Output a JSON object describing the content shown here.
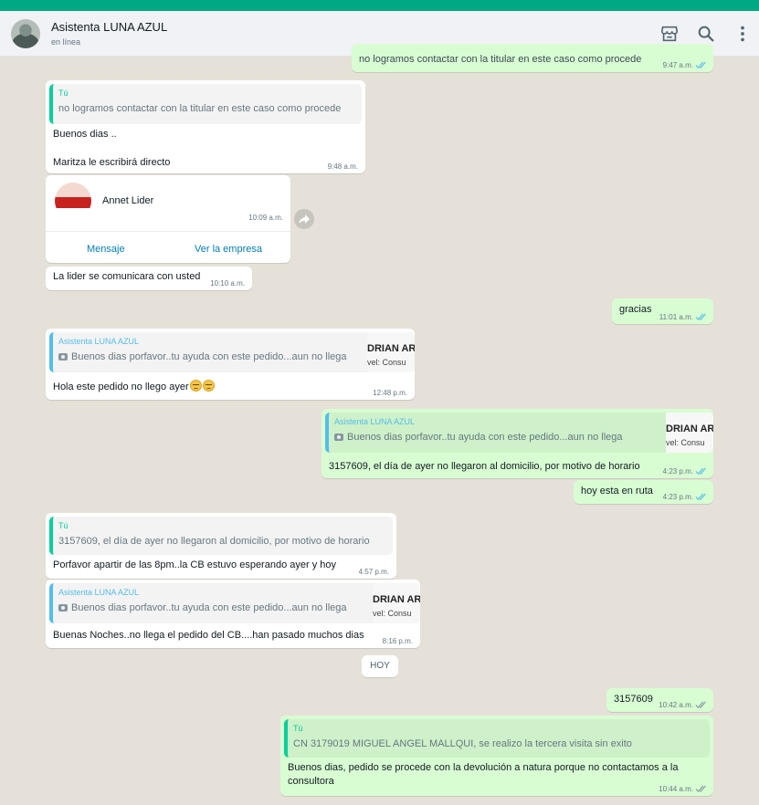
{
  "header": {
    "contact_name": "Asistenta LUNA AZUL",
    "status": "en línea",
    "icons": [
      "store-icon",
      "search-icon",
      "more-vert-icon"
    ]
  },
  "colors": {
    "accent": "#00a884",
    "outgoing": "#d9fdd3",
    "incoming": "#ffffff",
    "link": "#027eb5",
    "tick_read": "#53bdeb"
  },
  "messages": {
    "m0": {
      "text": "no logramos contactar con la titular en este caso como procede",
      "time": "9:47 a.m."
    },
    "m1": {
      "quote_author": "Tú",
      "quote_text": "no logramos contactar con la titular en este caso como procede",
      "line1": "Buenos dias ..",
      "line2": "Maritza le escribirá directo",
      "time": "9:48 a.m."
    },
    "m2": {
      "contact_name": "Annet Lider",
      "time": "10:09 a.m.",
      "action1": "Mensaje",
      "action2": "Ver la empresa"
    },
    "m3": {
      "text": "La lider se comunicara con usted",
      "time": "10:10 a.m."
    },
    "m4": {
      "text": "gracias",
      "time": "11:01 a.m."
    },
    "m5": {
      "quote_author": "Asistenta LUNA AZUL",
      "quote_text": "Buenos dias porfavor..tu ayuda con este pedido...aun no llega",
      "thumb1": "DRIAN AR",
      "thumb2": "vel: Consu",
      "text": "Hola este pedido no llego ayer",
      "time": "12:48 p.m."
    },
    "m6": {
      "quote_author": "Asistenta LUNA AZUL",
      "quote_text": "Buenos dias porfavor..tu ayuda con este pedido...aun no llega",
      "thumb1": "DRIAN AR",
      "thumb2": "vel: Consu",
      "text": "3157609, el día de ayer no llegaron al domicilio, por motivo de horario",
      "time": "4:23 p.m."
    },
    "m7": {
      "text": "hoy esta en ruta",
      "time": "4:23 p.m."
    },
    "m8": {
      "quote_author": "Tú",
      "quote_text": "3157609, el día de ayer no llegaron al domicilio, por motivo de horario",
      "text": "Porfavor apartir de las 8pm..la CB estuvo esperando  ayer y hoy",
      "time": "4:57 p.m."
    },
    "m9": {
      "quote_author": "Asistenta LUNA AZUL",
      "quote_text": "Buenos dias porfavor..tu ayuda con este pedido...aun no llega",
      "thumb1": "DRIAN AR",
      "thumb2": "vel: Consu",
      "text": "Buenas Noches..no llega  el pedido del CB....han pasado muchos dias",
      "time": "8:16 p.m."
    },
    "day_chip": "HOY",
    "m10": {
      "text": "3157609",
      "time": "10:42 a.m."
    },
    "m11": {
      "quote_author": "Tú",
      "quote_text": "CN 3179019 MIGUEL ANGEL MALLQUI, se realizo la tercera visita sin exito",
      "line1": "Buenos dias, pedido se procede con la devolución a natura porque no contactamos a la",
      "line2": "consultora",
      "time": "10:44 a.m."
    }
  }
}
